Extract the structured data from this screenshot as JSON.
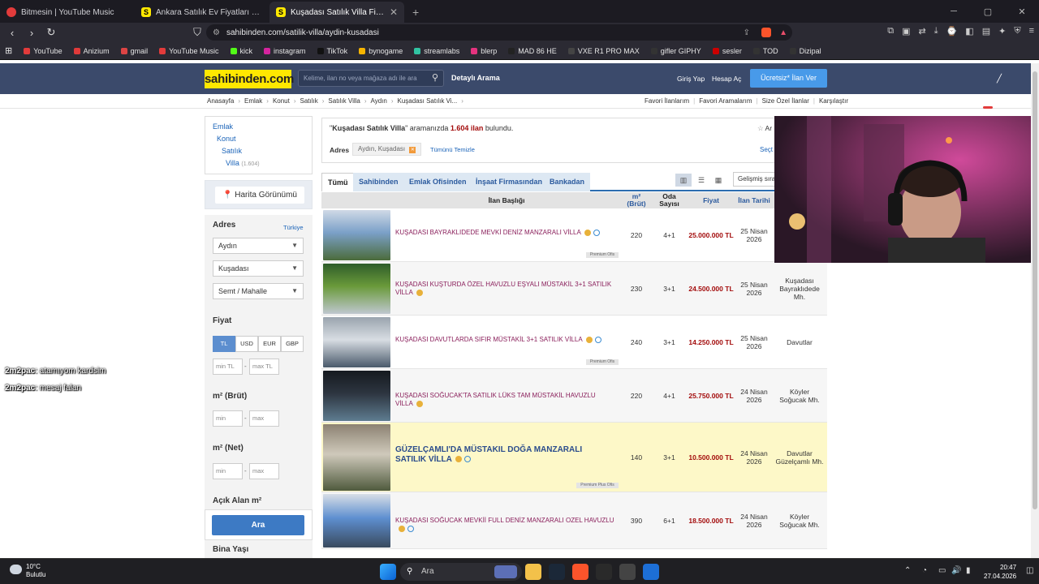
{
  "browser": {
    "tabs": [
      {
        "title": "Bitmesin | YouTube Music",
        "color": "#e23b3b"
      },
      {
        "title": "Ankara Satılık Ev Fiyatları sahibinden...",
        "color": "#ffe800"
      },
      {
        "title": "Kuşadası Satılık Villa Fiyatları ve",
        "color": "#ffe800"
      }
    ],
    "url": "sahibinden.com/satilik-villa/aydin-kusadasi",
    "bookmarks": [
      {
        "label": "YouTube",
        "color": "#e23b3b"
      },
      {
        "label": "Anizium",
        "color": "#e03a3a"
      },
      {
        "label": "gmail",
        "color": "#d44"
      },
      {
        "label": "YouTube Music",
        "color": "#e23b3b"
      },
      {
        "label": "kick",
        "color": "#53fc18"
      },
      {
        "label": "instagram",
        "color": "#d6249f"
      },
      {
        "label": "TikTok",
        "color": "#111"
      },
      {
        "label": "bynogame",
        "color": "#f6b400"
      },
      {
        "label": "streamlabs",
        "color": "#31c3a2"
      },
      {
        "label": "blerp",
        "color": "#e5337f"
      },
      {
        "label": "MAD 86 HE",
        "color": "#222"
      },
      {
        "label": "VXE R1 PRO MAX",
        "color": "#444"
      },
      {
        "label": "gifler GIPHY",
        "color": "#333"
      },
      {
        "label": "sesler",
        "color": "#c00"
      },
      {
        "label": "TOD",
        "color": "#333"
      },
      {
        "label": "Dizipal",
        "color": "#333"
      }
    ]
  },
  "site": {
    "logo": "sahibinden.com",
    "search_placeholder": "Kelime, ilan no veya mağaza adı ile ara",
    "advanced": "Detaylı Arama",
    "login": "Giriş Yap",
    "signup": "Hesap Aç",
    "post_ad": "Ücretsiz* İlan Ver",
    "breadcrumb": [
      "Anasayfa",
      "Emlak",
      "Konut",
      "Satılık",
      "Satılık Villa",
      "Aydın",
      "Kuşadası Satılık Vi..."
    ],
    "right_links": [
      "Favori İlanlarım",
      "|",
      "Favori Aramalarım",
      "|",
      "Size Özel İlanlar",
      "|",
      "Karşılaştır"
    ]
  },
  "sidebar": {
    "cats": [
      {
        "label": "Emlak"
      },
      {
        "label": "Konut"
      },
      {
        "label": "Satılık"
      },
      {
        "label": "Villa",
        "count": "(1.604)"
      }
    ],
    "map_button": "Harita Görünümü",
    "address_title": "Adres",
    "address_link": "Türkiye",
    "city": "Aydın",
    "district": "Kuşadası",
    "neighborhood": "Semt / Mahalle",
    "price_title": "Fiyat",
    "currencies": [
      "TL",
      "USD",
      "EUR",
      "GBP"
    ],
    "min_tl": "min TL",
    "max_tl": "max TL",
    "m2_brut": "m² (Brüt)",
    "m2_net": "m² (Net)",
    "min": "min",
    "max": "max",
    "open_area": "Açık Alan m²",
    "search_btn": "Ara",
    "building_age": "Bina Yaşı"
  },
  "results": {
    "query": "Kuşadası Satılık Villa",
    "mid": "aramanızda",
    "count": "1.604 ilan",
    "suffix": "bulundu.",
    "address_label": "Adres",
    "address_chip": "Aydın, Kuşadası",
    "clear_all": "Tümünü Temizle",
    "right_trunc": "Ar",
    "select_trunc": "Seçt",
    "tabs": [
      "Tümü",
      "Sahibinden",
      "Emlak Ofisinden",
      "İnşaat Firmasından",
      "Bankadan"
    ],
    "sort": "Gelişmiş sıra",
    "headers": {
      "title": "İlan Başlığı",
      "m2": "m²\n(Brüt)",
      "rooms": "Oda\nSayısı",
      "price": "Fiyat",
      "date": "İlan Tarihi"
    }
  },
  "listings": [
    {
      "title": "KUŞADASI BAYRAKLIDEDE MEVKİ DENİZ MANZARALI VİLLA",
      "m2": "220",
      "rooms": "4+1",
      "price": "25.000.000 TL",
      "date": "25 Nisan\n2026",
      "loc": "",
      "badge": "Premium Ofis",
      "feat": false
    },
    {
      "title": "KUŞADASI KUŞTURDA ÖZEL HAVUZLU EŞYALI MÜSTAKİL 3+1 SATILIK VİLLA",
      "m2": "230",
      "rooms": "3+1",
      "price": "24.500.000 TL",
      "date": "25 Nisan\n2026",
      "loc": "Kuşadası\nBayraklıdede\nMh.",
      "badge": "",
      "feat": false
    },
    {
      "title": "KUŞADASI DAVUTLARDA SIFIR MÜSTAKİL 3+1 SATILIK VİLLA",
      "m2": "240",
      "rooms": "3+1",
      "price": "14.250.000 TL",
      "date": "25 Nisan\n2026",
      "loc": "Davutlar",
      "badge": "Premium Ofis",
      "feat": false
    },
    {
      "title": "KUŞADASI SOĞUCAK'TA SATILIK LÜKS TAM MÜSTAKİL HAVUZLU VİLLA",
      "m2": "220",
      "rooms": "4+1",
      "price": "25.750.000 TL",
      "date": "24 Nisan\n2026",
      "loc": "Köyler\nSoğucak Mh.",
      "badge": "",
      "feat": false
    },
    {
      "title": "GÜZELÇAMLI'DA MÜSTAKIL DOĞA MANZARALI SATILIK VİLLA",
      "m2": "140",
      "rooms": "3+1",
      "price": "10.500.000 TL",
      "date": "24 Nisan\n2026",
      "loc": "Davutlar\nGüzelçamlı Mh.",
      "badge": "Premium Plus Ofis",
      "feat": true
    },
    {
      "title": "KUŞADASI SOĞUCAK MEVKİİ FULL DENİZ MANZARALI OZEL HAVUZLU",
      "m2": "390",
      "rooms": "6+1",
      "price": "18.500.000 TL",
      "date": "24 Nisan\n2026",
      "loc": "Köyler\nSoğucak Mh.",
      "badge": "",
      "feat": false
    }
  ],
  "chat": [
    {
      "user": "2m2pac",
      "msg": ": atamıyom kardsim"
    },
    {
      "user": "2m2pac",
      "msg": ": mesaj falan"
    }
  ],
  "taskbar": {
    "temp": "10°C",
    "weather": "Bulutlu",
    "search": "Ara",
    "time": "20:47",
    "date": "27.04.2026"
  }
}
